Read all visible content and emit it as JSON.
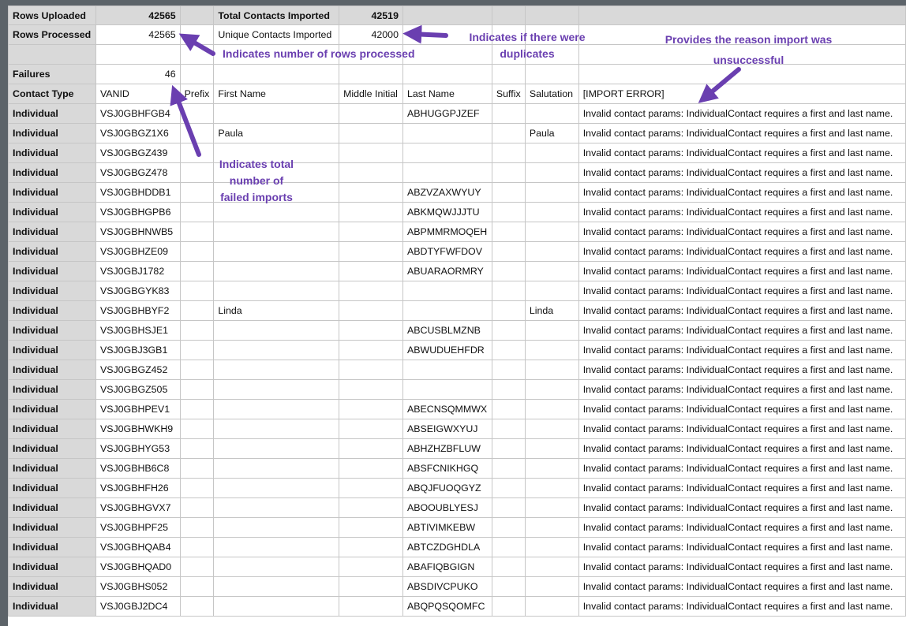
{
  "summary": {
    "rows_uploaded_label": "Rows Uploaded",
    "rows_uploaded_value": "42565",
    "total_contacts_label": "Total Contacts Imported",
    "total_contacts_value": "42519",
    "rows_processed_label": "Rows Processed",
    "rows_processed_value": "42565",
    "unique_contacts_label": "Unique Contacts Imported",
    "unique_contacts_value": "42000",
    "failures_label": "Failures",
    "failures_value": "46"
  },
  "headers": [
    "Contact Type",
    "VANID",
    "Prefix",
    "First Name",
    "Middle Initial",
    "Last Name",
    "Suffix",
    "Salutation",
    "[IMPORT ERROR]"
  ],
  "rows": [
    {
      "type": "Individual",
      "vanid": "VSJ0GBHFGB4",
      "prefix": "",
      "first": "",
      "middle": "",
      "last": "ABHUGGPJZEF",
      "suffix": "",
      "salutation": "",
      "error": "Invalid contact params: IndividualContact requires a first and last name."
    },
    {
      "type": "Individual",
      "vanid": "VSJ0GBGZ1X6",
      "prefix": "",
      "first": "Paula",
      "middle": "",
      "last": "",
      "suffix": "",
      "salutation": "Paula",
      "error": "Invalid contact params: IndividualContact requires a first and last name."
    },
    {
      "type": "Individual",
      "vanid": "VSJ0GBGZ439",
      "prefix": "",
      "first": "",
      "middle": "",
      "last": "",
      "suffix": "",
      "salutation": "",
      "error": "Invalid contact params: IndividualContact requires a first and last name."
    },
    {
      "type": "Individual",
      "vanid": "VSJ0GBGZ478",
      "prefix": "",
      "first": "",
      "middle": "",
      "last": "",
      "suffix": "",
      "salutation": "",
      "error": "Invalid contact params: IndividualContact requires a first and last name."
    },
    {
      "type": "Individual",
      "vanid": "VSJ0GBHDDB1",
      "prefix": "",
      "first": "",
      "middle": "",
      "last": "ABZVZAXWYUY",
      "suffix": "",
      "salutation": "",
      "error": "Invalid contact params: IndividualContact requires a first and last name."
    },
    {
      "type": "Individual",
      "vanid": "VSJ0GBHGPB6",
      "prefix": "",
      "first": "",
      "middle": "",
      "last": "ABKMQWJJJTU",
      "suffix": "",
      "salutation": "",
      "error": "Invalid contact params: IndividualContact requires a first and last name."
    },
    {
      "type": "Individual",
      "vanid": "VSJ0GBHNWB5",
      "prefix": "",
      "first": "",
      "middle": "",
      "last": "ABPMMRMOQEH",
      "suffix": "",
      "salutation": "",
      "error": "Invalid contact params: IndividualContact requires a first and last name."
    },
    {
      "type": "Individual",
      "vanid": "VSJ0GBHZE09",
      "prefix": "",
      "first": "",
      "middle": "",
      "last": "ABDTYFWFDOV",
      "suffix": "",
      "salutation": "",
      "error": "Invalid contact params: IndividualContact requires a first and last name."
    },
    {
      "type": "Individual",
      "vanid": "VSJ0GBJ1782",
      "prefix": "",
      "first": "",
      "middle": "",
      "last": "ABUARAORMRY",
      "suffix": "",
      "salutation": "",
      "error": "Invalid contact params: IndividualContact requires a first and last name."
    },
    {
      "type": "Individual",
      "vanid": "VSJ0GBGYK83",
      "prefix": "",
      "first": "",
      "middle": "",
      "last": "",
      "suffix": "",
      "salutation": "",
      "error": "Invalid contact params: IndividualContact requires a first and last name."
    },
    {
      "type": "Individual",
      "vanid": "VSJ0GBHBYF2",
      "prefix": "",
      "first": "Linda",
      "middle": "",
      "last": "",
      "suffix": "",
      "salutation": "Linda",
      "error": "Invalid contact params: IndividualContact requires a first and last name."
    },
    {
      "type": "Individual",
      "vanid": "VSJ0GBHSJE1",
      "prefix": "",
      "first": "",
      "middle": "",
      "last": "ABCUSBLMZNB",
      "suffix": "",
      "salutation": "",
      "error": "Invalid contact params: IndividualContact requires a first and last name."
    },
    {
      "type": "Individual",
      "vanid": "VSJ0GBJ3GB1",
      "prefix": "",
      "first": "",
      "middle": "",
      "last": "ABWUDUEHFDR",
      "suffix": "",
      "salutation": "",
      "error": "Invalid contact params: IndividualContact requires a first and last name."
    },
    {
      "type": "Individual",
      "vanid": "VSJ0GBGZ452",
      "prefix": "",
      "first": "",
      "middle": "",
      "last": "",
      "suffix": "",
      "salutation": "",
      "error": "Invalid contact params: IndividualContact requires a first and last name."
    },
    {
      "type": "Individual",
      "vanid": "VSJ0GBGZ505",
      "prefix": "",
      "first": "",
      "middle": "",
      "last": "",
      "suffix": "",
      "salutation": "",
      "error": "Invalid contact params: IndividualContact requires a first and last name."
    },
    {
      "type": "Individual",
      "vanid": "VSJ0GBHPEV1",
      "prefix": "",
      "first": "",
      "middle": "",
      "last": "ABECNSQMMWX",
      "suffix": "",
      "salutation": "",
      "error": "Invalid contact params: IndividualContact requires a first and last name."
    },
    {
      "type": "Individual",
      "vanid": "VSJ0GBHWKH9",
      "prefix": "",
      "first": "",
      "middle": "",
      "last": "ABSEIGWXYUJ",
      "suffix": "",
      "salutation": "",
      "error": "Invalid contact params: IndividualContact requires a first and last name."
    },
    {
      "type": "Individual",
      "vanid": "VSJ0GBHYG53",
      "prefix": "",
      "first": "",
      "middle": "",
      "last": "ABHZHZBFLUW",
      "suffix": "",
      "salutation": "",
      "error": "Invalid contact params: IndividualContact requires a first and last name."
    },
    {
      "type": "Individual",
      "vanid": "VSJ0GBHB6C8",
      "prefix": "",
      "first": "",
      "middle": "",
      "last": "ABSFCNIKHGQ",
      "suffix": "",
      "salutation": "",
      "error": "Invalid contact params: IndividualContact requires a first and last name."
    },
    {
      "type": "Individual",
      "vanid": "VSJ0GBHFH26",
      "prefix": "",
      "first": "",
      "middle": "",
      "last": "ABQJFUOQGYZ",
      "suffix": "",
      "salutation": "",
      "error": "Invalid contact params: IndividualContact requires a first and last name."
    },
    {
      "type": "Individual",
      "vanid": "VSJ0GBHGVX7",
      "prefix": "",
      "first": "",
      "middle": "",
      "last": "ABOOUBLYESJ",
      "suffix": "",
      "salutation": "",
      "error": "Invalid contact params: IndividualContact requires a first and last name."
    },
    {
      "type": "Individual",
      "vanid": "VSJ0GBHPF25",
      "prefix": "",
      "first": "",
      "middle": "",
      "last": "ABTIVIMKEBW",
      "suffix": "",
      "salutation": "",
      "error": "Invalid contact params: IndividualContact requires a first and last name."
    },
    {
      "type": "Individual",
      "vanid": "VSJ0GBHQAB4",
      "prefix": "",
      "first": "",
      "middle": "",
      "last": "ABTCZDGHDLA",
      "suffix": "",
      "salutation": "",
      "error": "Invalid contact params: IndividualContact requires a first and last name."
    },
    {
      "type": "Individual",
      "vanid": "VSJ0GBHQAD0",
      "prefix": "",
      "first": "",
      "middle": "",
      "last": "ABAFIQBGIGN",
      "suffix": "",
      "salutation": "",
      "error": "Invalid contact params: IndividualContact requires a first and last name."
    },
    {
      "type": "Individual",
      "vanid": "VSJ0GBHS052",
      "prefix": "",
      "first": "",
      "middle": "",
      "last": "ABSDIVCPUKO",
      "suffix": "",
      "salutation": "",
      "error": "Invalid contact params: IndividualContact requires a first and last name."
    },
    {
      "type": "Individual",
      "vanid": "VSJ0GBJ2DC4",
      "prefix": "",
      "first": "",
      "middle": "",
      "last": "ABQPQSQOMFC",
      "suffix": "",
      "salutation": "",
      "error": "Invalid contact params: IndividualContact requires a first and last name."
    }
  ],
  "annotations": {
    "rows_processed_note": "Indicates number of rows processed",
    "duplicates_note_line1": "Indicates if there were",
    "duplicates_note_line2": "duplicates",
    "reason_note_line1": "Provides the reason import was",
    "reason_note_line2": "unsuccessful",
    "failures_note_line1": "Indicates total",
    "failures_note_line2": "number of",
    "failures_note_line3": "failed imports"
  },
  "colors": {
    "annotation": "#6a3fb0",
    "header_fill": "#d9d9d9",
    "gridline": "#c6c6c6",
    "background": "#5c6369"
  }
}
